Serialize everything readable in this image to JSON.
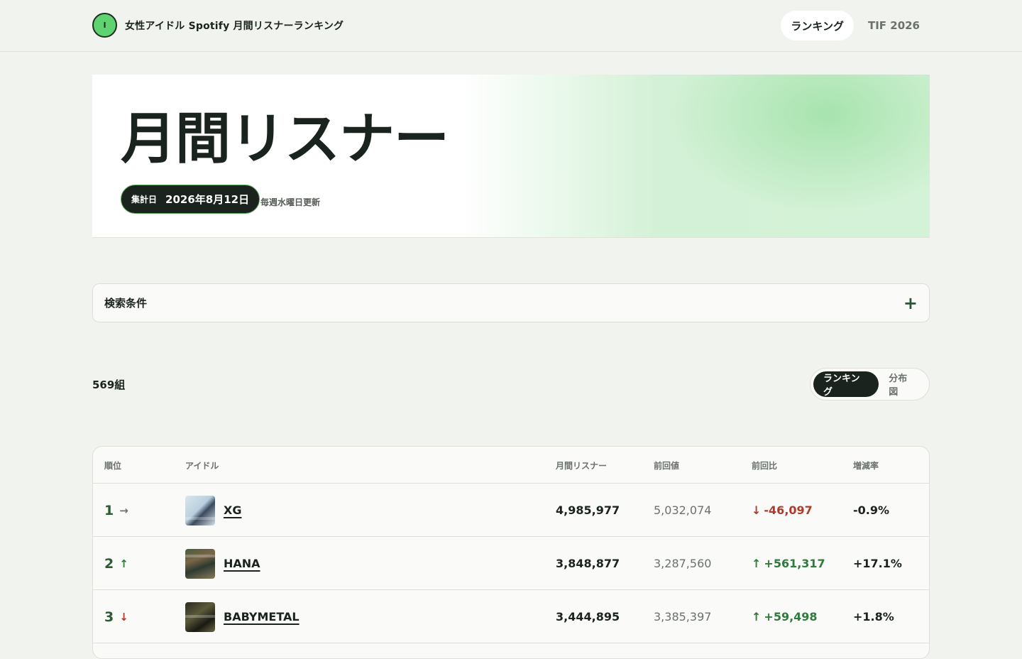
{
  "header": {
    "logo_letter": "I",
    "site_title": "女性アイドル Spotify 月間リスナーランキング",
    "nav": [
      {
        "label": "ランキング",
        "active": true
      },
      {
        "label": "TIF 2026",
        "active": false
      }
    ]
  },
  "hero": {
    "title": "月間リスナー",
    "date_label": "集計日",
    "date_value": "2026年8月12日",
    "update_note": "毎週水曜日更新"
  },
  "search": {
    "label": "検索条件",
    "expand_icon": "plus-icon"
  },
  "results": {
    "count": "569組",
    "view_toggle": [
      {
        "label": "ランキング",
        "active": true
      },
      {
        "label": "分布図",
        "active": false
      }
    ]
  },
  "table": {
    "headers": {
      "rank": "順位",
      "idol": "アイドル",
      "listeners": "月間リスナー",
      "previous": "前回値",
      "diff": "前回比",
      "rate": "増減率"
    },
    "rows": [
      {
        "rank": "1",
        "trend": "→",
        "trend_dir": "same",
        "name": "XG",
        "listeners": "4,985,977",
        "previous": "5,032,074",
        "diff_arrow": "↓",
        "diff": "-46,097",
        "diff_dir": "down",
        "rate": "-0.9%"
      },
      {
        "rank": "2",
        "trend": "↑",
        "trend_dir": "up",
        "name": "HANA",
        "listeners": "3,848,877",
        "previous": "3,287,560",
        "diff_arrow": "↑",
        "diff": "+561,317",
        "diff_dir": "up",
        "rate": "+17.1%"
      },
      {
        "rank": "3",
        "trend": "↓",
        "trend_dir": "down",
        "name": "BABYMETAL",
        "listeners": "3,444,895",
        "previous": "3,385,397",
        "diff_arrow": "↑",
        "diff": "+59,498",
        "diff_dir": "up",
        "rate": "+1.8%"
      }
    ]
  },
  "colors": {
    "background": "#f1f3ee",
    "accent_green": "#5fd36f",
    "dark": "#1a231d",
    "up": "#2f7a3c",
    "down": "#b03a2a"
  }
}
